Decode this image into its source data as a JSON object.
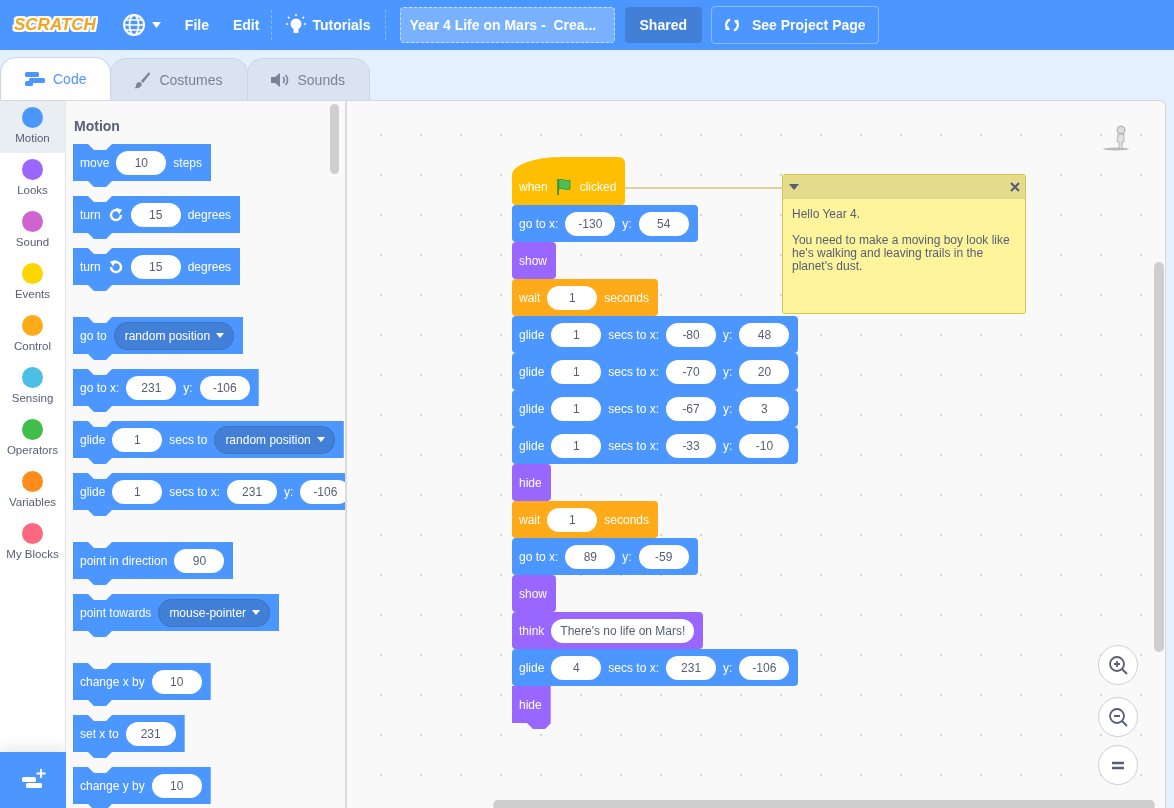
{
  "menu_bar": {
    "logo": "SCRATCH",
    "file": "File",
    "edit": "Edit",
    "tutorials": "Tutorials",
    "project_title": "Year 4 Life on Mars -  Crea...",
    "shared_button": "Shared",
    "project_page_button": "See Project Page"
  },
  "tabs": [
    {
      "label": "Code",
      "selected": true
    },
    {
      "label": "Costumes",
      "selected": false
    },
    {
      "label": "Sounds",
      "selected": false
    }
  ],
  "categories": [
    {
      "label": "Motion",
      "color": "#4c97ff",
      "selected": true
    },
    {
      "label": "Looks",
      "color": "#9966ff",
      "selected": false
    },
    {
      "label": "Sound",
      "color": "#cf63cf",
      "selected": false
    },
    {
      "label": "Events",
      "color": "#ffd500",
      "selected": false
    },
    {
      "label": "Control",
      "color": "#ffab19",
      "selected": false
    },
    {
      "label": "Sensing",
      "color": "#4cbfe6",
      "selected": false
    },
    {
      "label": "Operators",
      "color": "#40bf4a",
      "selected": false
    },
    {
      "label": "Variables",
      "color": "#ff8c1a",
      "selected": false
    },
    {
      "label": "My Blocks",
      "color": "#ff6680",
      "selected": false
    }
  ],
  "palette": {
    "heading": "Motion",
    "groups": [
      {
        "blocks": [
          {
            "kind": "motion",
            "parts": [
              {
                "kind": "text",
                "text": "move"
              },
              {
                "kind": "number",
                "text": "10"
              },
              {
                "kind": "text",
                "text": "steps"
              }
            ]
          },
          {
            "kind": "motion",
            "parts": [
              {
                "kind": "text",
                "text": "turn"
              },
              {
                "kind": "rotate-right"
              },
              {
                "kind": "number",
                "text": "15"
              },
              {
                "kind": "text",
                "text": "degrees"
              }
            ]
          },
          {
            "kind": "motion",
            "parts": [
              {
                "kind": "text",
                "text": "turn"
              },
              {
                "kind": "rotate-left"
              },
              {
                "kind": "number",
                "text": "15"
              },
              {
                "kind": "text",
                "text": "degrees"
              }
            ]
          }
        ]
      },
      {
        "blocks": [
          {
            "kind": "motion",
            "parts": [
              {
                "kind": "text",
                "text": "go to"
              },
              {
                "kind": "dropdown",
                "text": "random position"
              }
            ]
          },
          {
            "kind": "motion",
            "parts": [
              {
                "kind": "text",
                "text": "go to x:"
              },
              {
                "kind": "number",
                "text": "231"
              },
              {
                "kind": "text",
                "text": "y:"
              },
              {
                "kind": "number",
                "text": "-106"
              }
            ]
          },
          {
            "kind": "motion",
            "parts": [
              {
                "kind": "text",
                "text": "glide"
              },
              {
                "kind": "number",
                "text": "1"
              },
              {
                "kind": "text",
                "text": "secs to"
              },
              {
                "kind": "dropdown",
                "text": "random position"
              }
            ]
          },
          {
            "kind": "motion",
            "parts": [
              {
                "kind": "text",
                "text": "glide"
              },
              {
                "kind": "number",
                "text": "1"
              },
              {
                "kind": "text",
                "text": "secs to x:"
              },
              {
                "kind": "number",
                "text": "231"
              },
              {
                "kind": "text",
                "text": "y:"
              },
              {
                "kind": "number",
                "text": "-106"
              }
            ]
          }
        ]
      },
      {
        "blocks": [
          {
            "kind": "motion",
            "parts": [
              {
                "kind": "text",
                "text": "point in direction"
              },
              {
                "kind": "number",
                "text": "90"
              }
            ]
          },
          {
            "kind": "motion",
            "parts": [
              {
                "kind": "text",
                "text": "point towards"
              },
              {
                "kind": "dropdown",
                "text": "mouse-pointer"
              }
            ]
          }
        ]
      },
      {
        "blocks": [
          {
            "kind": "motion",
            "parts": [
              {
                "kind": "text",
                "text": "change x by"
              },
              {
                "kind": "number",
                "text": "10"
              }
            ]
          },
          {
            "kind": "motion",
            "parts": [
              {
                "kind": "text",
                "text": "set x to"
              },
              {
                "kind": "number",
                "text": "231"
              }
            ]
          },
          {
            "kind": "motion",
            "parts": [
              {
                "kind": "text",
                "text": "change y by"
              },
              {
                "kind": "number",
                "text": "10"
              }
            ]
          }
        ]
      }
    ]
  },
  "workspace": {
    "script": [
      {
        "kind": "hat",
        "parts": [
          {
            "kind": "text",
            "text": "when"
          },
          {
            "kind": "flag"
          },
          {
            "kind": "text",
            "text": "clicked"
          }
        ]
      },
      {
        "kind": "motion",
        "parts": [
          {
            "kind": "text",
            "text": "go to x:"
          },
          {
            "kind": "number",
            "text": "-130"
          },
          {
            "kind": "text",
            "text": "y:"
          },
          {
            "kind": "number",
            "text": "54"
          }
        ]
      },
      {
        "kind": "looks",
        "parts": [
          {
            "kind": "text",
            "text": "show"
          }
        ]
      },
      {
        "kind": "control",
        "parts": [
          {
            "kind": "text",
            "text": "wait"
          },
          {
            "kind": "number",
            "text": "1"
          },
          {
            "kind": "text",
            "text": "seconds"
          }
        ]
      },
      {
        "kind": "motion",
        "parts": [
          {
            "kind": "text",
            "text": "glide"
          },
          {
            "kind": "number",
            "text": "1"
          },
          {
            "kind": "text",
            "text": "secs to x:"
          },
          {
            "kind": "number",
            "text": "-80"
          },
          {
            "kind": "text",
            "text": "y:"
          },
          {
            "kind": "number",
            "text": "48"
          }
        ]
      },
      {
        "kind": "motion",
        "parts": [
          {
            "kind": "text",
            "text": "glide"
          },
          {
            "kind": "number",
            "text": "1"
          },
          {
            "kind": "text",
            "text": "secs to x:"
          },
          {
            "kind": "number",
            "text": "-70"
          },
          {
            "kind": "text",
            "text": "y:"
          },
          {
            "kind": "number",
            "text": "20"
          }
        ]
      },
      {
        "kind": "motion",
        "parts": [
          {
            "kind": "text",
            "text": "glide"
          },
          {
            "kind": "number",
            "text": "1"
          },
          {
            "kind": "text",
            "text": "secs to x:"
          },
          {
            "kind": "number",
            "text": "-67"
          },
          {
            "kind": "text",
            "text": "y:"
          },
          {
            "kind": "number",
            "text": "3"
          }
        ]
      },
      {
        "kind": "motion",
        "parts": [
          {
            "kind": "text",
            "text": "glide"
          },
          {
            "kind": "number",
            "text": "1"
          },
          {
            "kind": "text",
            "text": "secs to x:"
          },
          {
            "kind": "number",
            "text": "-33"
          },
          {
            "kind": "text",
            "text": "y:"
          },
          {
            "kind": "number",
            "text": "-10"
          }
        ]
      },
      {
        "kind": "looks",
        "parts": [
          {
            "kind": "text",
            "text": "hide"
          }
        ]
      },
      {
        "kind": "control",
        "parts": [
          {
            "kind": "text",
            "text": "wait"
          },
          {
            "kind": "number",
            "text": "1"
          },
          {
            "kind": "text",
            "text": "seconds"
          }
        ]
      },
      {
        "kind": "motion",
        "parts": [
          {
            "kind": "text",
            "text": "go to x:"
          },
          {
            "kind": "number",
            "text": "89"
          },
          {
            "kind": "text",
            "text": "y:"
          },
          {
            "kind": "number",
            "text": "-59"
          }
        ]
      },
      {
        "kind": "looks",
        "parts": [
          {
            "kind": "text",
            "text": "show"
          }
        ]
      },
      {
        "kind": "looks",
        "parts": [
          {
            "kind": "text",
            "text": "think"
          },
          {
            "kind": "string",
            "text": "There's no life on Mars!"
          }
        ]
      },
      {
        "kind": "motion",
        "parts": [
          {
            "kind": "text",
            "text": "glide"
          },
          {
            "kind": "number",
            "text": "4"
          },
          {
            "kind": "text",
            "text": "secs to x:"
          },
          {
            "kind": "number",
            "text": "231"
          },
          {
            "kind": "text",
            "text": "y:"
          },
          {
            "kind": "number",
            "text": "-106"
          }
        ]
      },
      {
        "kind": "looks",
        "parts": [
          {
            "kind": "text",
            "text": "hide"
          }
        ]
      }
    ],
    "comment": {
      "text": "Hello Year 4.\n\nYou need to make a moving boy look like he's walking and leaving trails in the planet's dust."
    }
  }
}
